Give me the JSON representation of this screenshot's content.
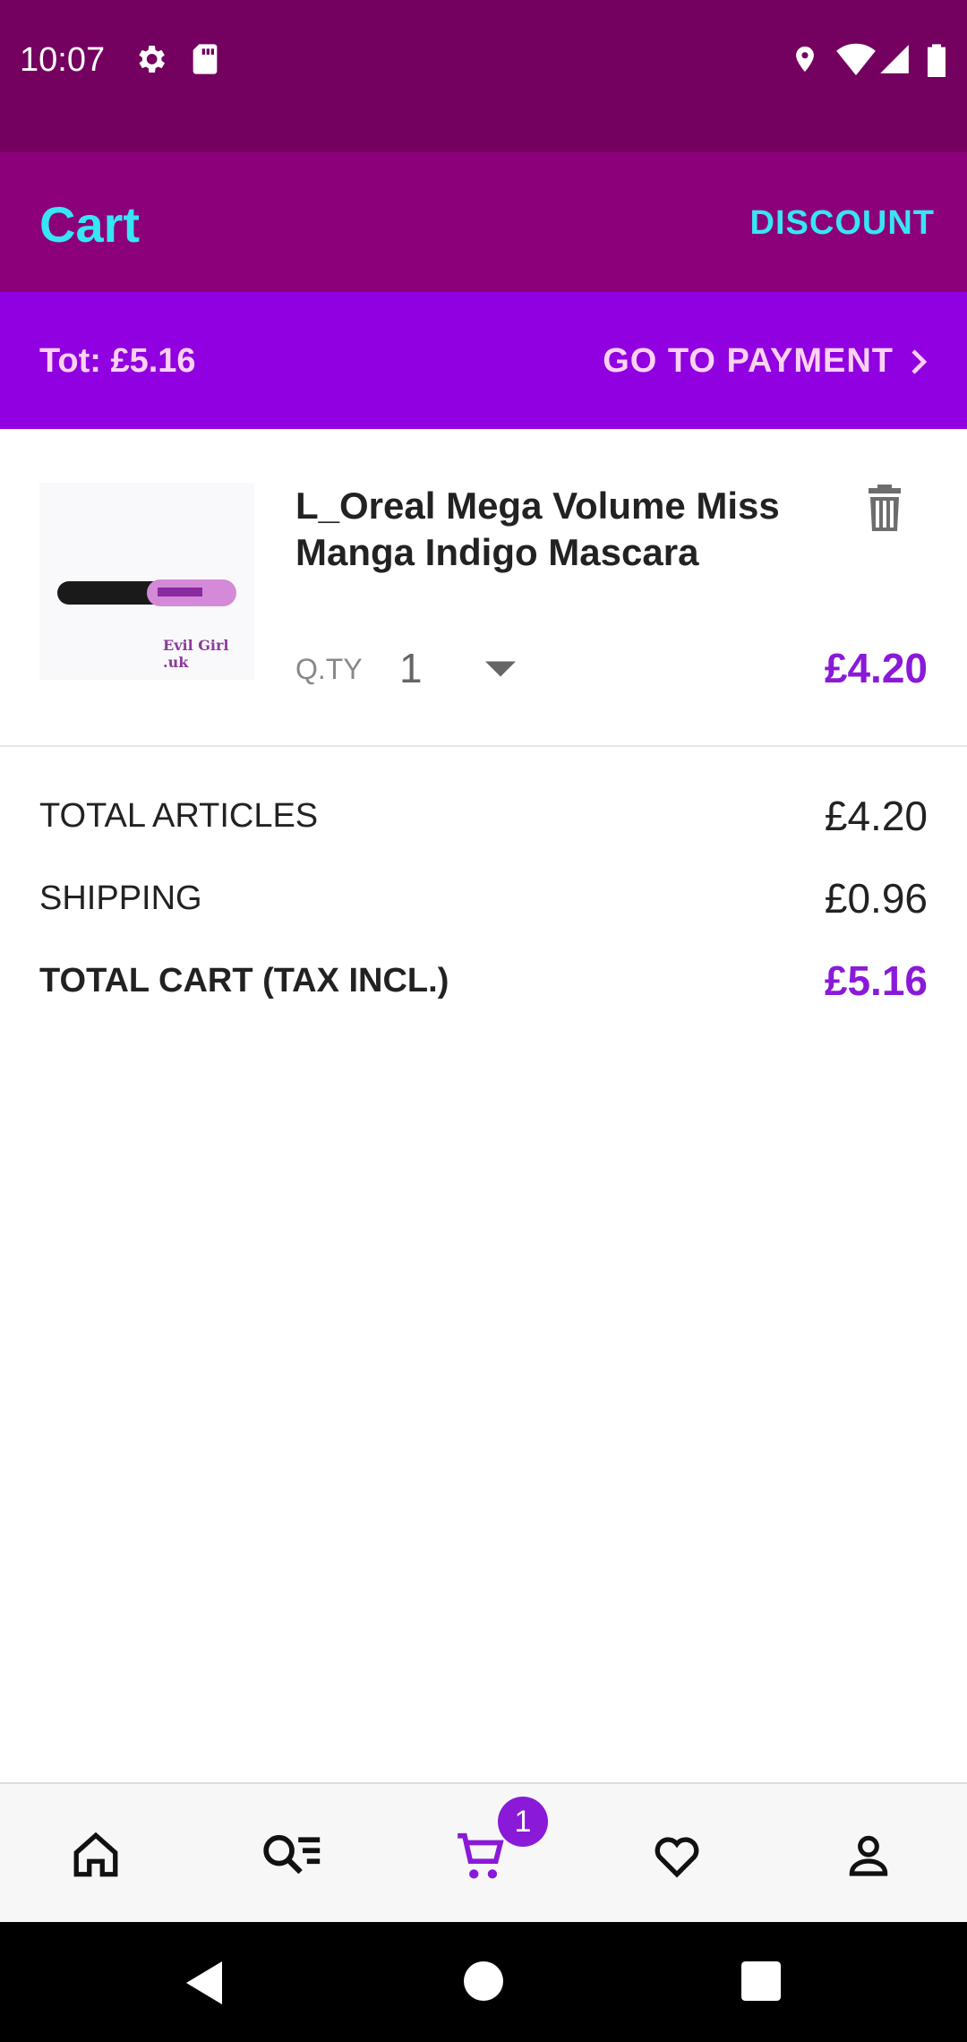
{
  "status_bar": {
    "time": "10:07",
    "icons": [
      "gear-icon",
      "sd-card-icon",
      "location-icon",
      "wifi-icon",
      "signal-icon",
      "battery-icon"
    ]
  },
  "app_bar": {
    "title": "Cart",
    "discount_label": "DISCOUNT"
  },
  "payment_bar": {
    "total": "Tot: £5.16",
    "go_to_payment": "GO TO PAYMENT"
  },
  "cart": {
    "items": [
      {
        "title": "L_Oreal Mega Volume Miss Manga Indigo Mascara",
        "qty_label": "Q.TY",
        "qty": "1",
        "price": "£4.20",
        "image_caption": "Evil Girl .uk"
      }
    ]
  },
  "summary": {
    "total_articles_label": "TOTAL ARTICLES",
    "total_articles_value": "£4.20",
    "shipping_label": "SHIPPING",
    "shipping_value": "£0.96",
    "total_cart_label": "TOTAL CART (TAX INCL.)",
    "total_cart_value": "£5.16"
  },
  "bottom_nav": {
    "cart_badge": "1",
    "items": [
      "home-icon",
      "search-list-icon",
      "cart-icon",
      "heart-icon",
      "profile-icon"
    ]
  },
  "colors": {
    "status": "#74005f",
    "app_bar": "#8c007a",
    "payment_bar": "#9000e0",
    "accent": "#8a1ad8",
    "cyan": "#37e6f2"
  }
}
